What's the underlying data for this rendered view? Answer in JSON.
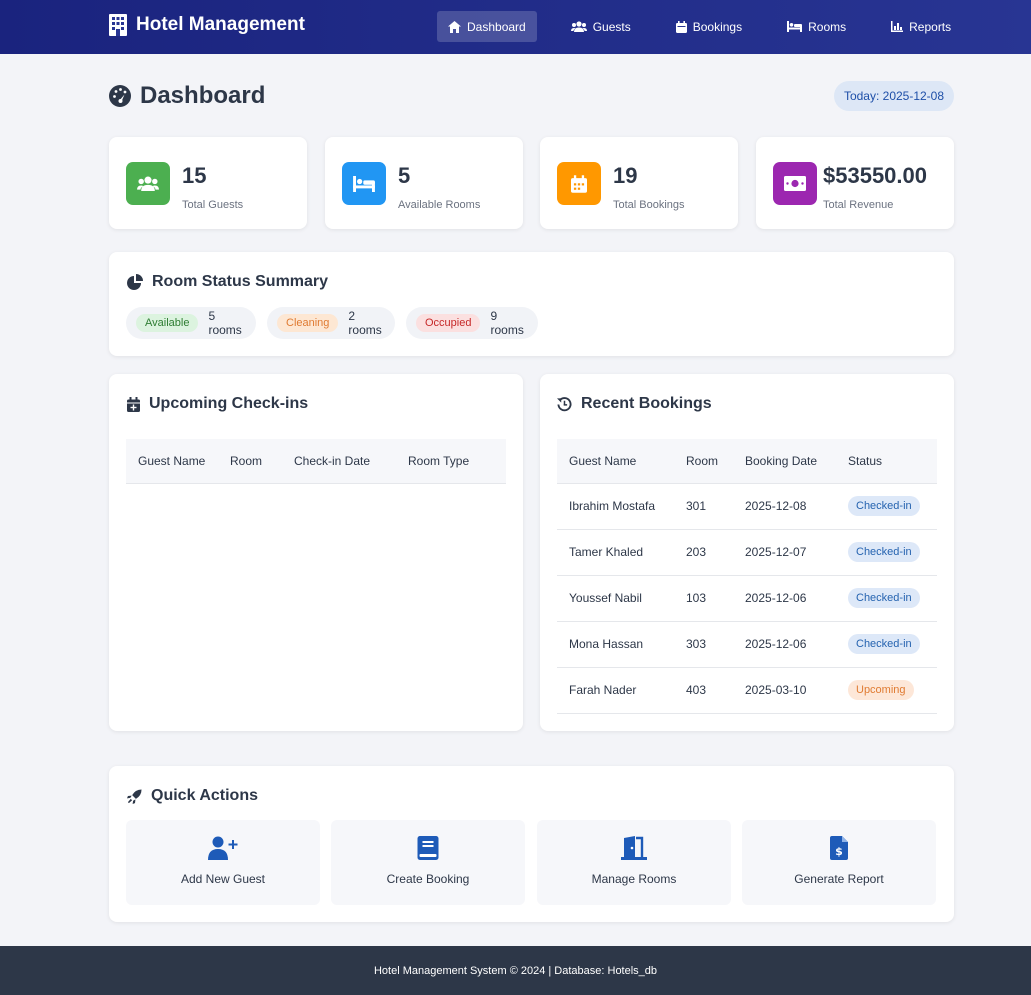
{
  "brand": {
    "title": "Hotel Management"
  },
  "nav": {
    "dashboard": "Dashboard",
    "guests": "Guests",
    "bookings": "Bookings",
    "rooms": "Rooms",
    "reports": "Reports"
  },
  "page": {
    "title": "Dashboard",
    "today": "Today: 2025-12-08"
  },
  "stats": {
    "guests": {
      "value": "15",
      "label": "Total Guests"
    },
    "rooms": {
      "value": "5",
      "label": "Available Rooms"
    },
    "bookings": {
      "value": "19",
      "label": "Total Bookings"
    },
    "revenue": {
      "value": "$53550.00",
      "label": "Total Revenue"
    }
  },
  "room_status": {
    "title": "Room Status Summary",
    "items": [
      {
        "tag": "Available",
        "count": "5 rooms"
      },
      {
        "tag": "Cleaning",
        "count": "2 rooms"
      },
      {
        "tag": "Occupied",
        "count": "9 rooms"
      }
    ]
  },
  "checkins": {
    "title": "Upcoming Check-ins",
    "headers": [
      "Guest Name",
      "Room",
      "Check-in Date",
      "Room Type"
    ]
  },
  "recent": {
    "title": "Recent Bookings",
    "headers": [
      "Guest Name",
      "Room",
      "Booking Date",
      "Status"
    ],
    "rows": [
      {
        "guest": "Ibrahim Mostafa",
        "room": "301",
        "date": "2025-12-08",
        "status": "Checked-in"
      },
      {
        "guest": "Tamer Khaled",
        "room": "203",
        "date": "2025-12-07",
        "status": "Checked-in"
      },
      {
        "guest": "Youssef Nabil",
        "room": "103",
        "date": "2025-12-06",
        "status": "Checked-in"
      },
      {
        "guest": "Mona Hassan",
        "room": "303",
        "date": "2025-12-06",
        "status": "Checked-in"
      },
      {
        "guest": "Farah Nader",
        "room": "403",
        "date": "2025-03-10",
        "status": "Upcoming"
      }
    ]
  },
  "quick_actions": {
    "title": "Quick Actions",
    "add_guest": "Add New Guest",
    "create_booking": "Create Booking",
    "manage_rooms": "Manage Rooms",
    "generate_report": "Generate Report"
  },
  "footer": {
    "text": "Hotel Management System © 2024 | Database: Hotels_db"
  },
  "colors": {
    "nav_bg": "#1a237e",
    "guests_icon": "#4caf50",
    "rooms_icon": "#2196f3",
    "bookings_icon": "#ff9800",
    "revenue_icon": "#9c27b0",
    "accent": "#1e5bb8"
  },
  "icons": {
    "brand": "building-icon",
    "dashboard": "home-icon",
    "guests": "users-icon",
    "bookings": "calendar-icon",
    "rooms": "bed-icon",
    "reports": "chart-icon"
  }
}
